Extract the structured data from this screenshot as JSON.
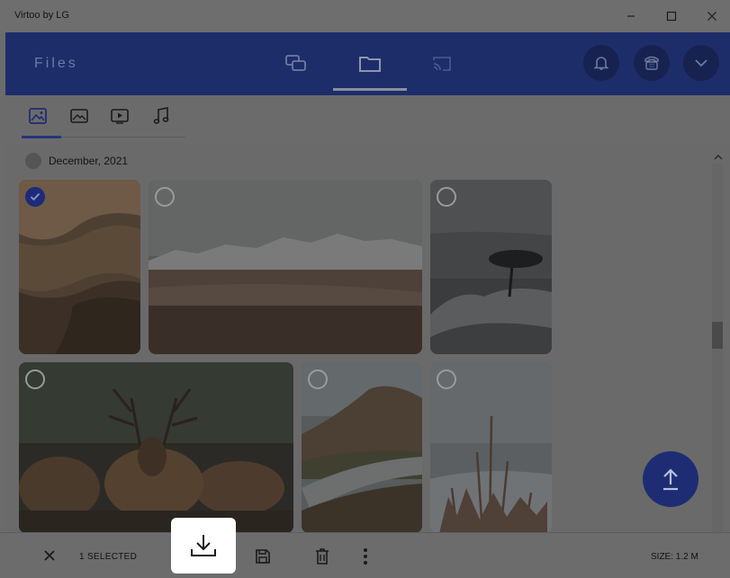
{
  "window": {
    "title": "Virtoo by LG"
  },
  "header": {
    "title": "Files",
    "nav_tabs": [
      {
        "icon": "chat-icon",
        "label": "Messages"
      },
      {
        "icon": "folder-icon",
        "label": "Files",
        "active": true
      },
      {
        "icon": "cast-icon",
        "label": "Cast"
      }
    ],
    "actions": [
      "bell-icon",
      "phone-icon",
      "chevron-down-icon"
    ]
  },
  "filter_tabs": [
    {
      "icon": "image-icon",
      "active": true
    },
    {
      "icon": "gallery-icon"
    },
    {
      "icon": "video-icon"
    },
    {
      "icon": "music-icon"
    }
  ],
  "section": {
    "label": "December, 2021"
  },
  "photos": [
    {
      "subject": "desert-dunes",
      "selected": true
    },
    {
      "subject": "snowy-mountains-plain",
      "selected": false
    },
    {
      "subject": "lone-tree-rocks",
      "selected": false
    },
    {
      "subject": "deer-herd",
      "selected": false
    },
    {
      "subject": "valley-road-hills",
      "selected": false
    },
    {
      "subject": "frosted-grass",
      "selected": false
    }
  ],
  "bottom_bar": {
    "selected_text": "1 SELECTED",
    "size_text": "SIZE: 1.2 M"
  },
  "colors": {
    "accent": "#1e2d73",
    "header_bg": "#1d2d6a",
    "overlay": "#6b6b6b"
  }
}
